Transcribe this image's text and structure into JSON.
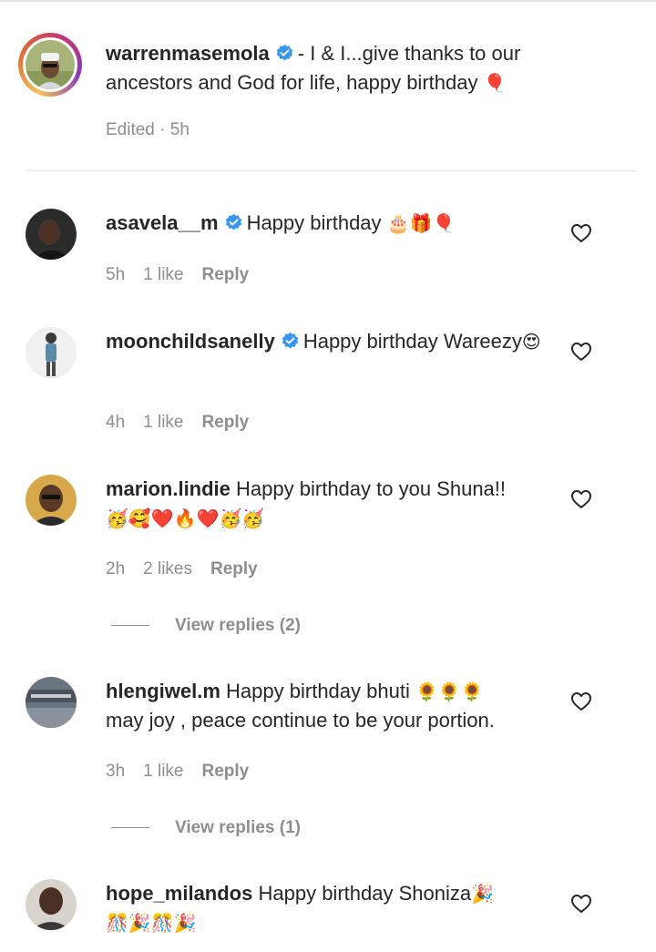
{
  "caption": {
    "username": "warrenmasemola",
    "text": "- I & I...give thanks to our ancestors and God for life, happy birthday",
    "emoji": "🎈",
    "meta": "Edited · 5h"
  },
  "comments": [
    {
      "username": "asavela__m",
      "verified": true,
      "text": "Happy birthday",
      "emoji": "🎂🎁🎈",
      "time": "5h",
      "likes": "1 like",
      "reply": "Reply"
    },
    {
      "username": "moonchildsanelly",
      "verified": true,
      "text": "Happy birthday Wareezy",
      "emoji": "😍",
      "time": "4h",
      "likes": "1 like",
      "reply": "Reply"
    },
    {
      "username": "marion.lindie",
      "verified": false,
      "text": "Happy birthday to you Shuna!!",
      "emoji": "🥳🥰❤️🔥❤️🥳🥳",
      "time": "2h",
      "likes": "2 likes",
      "reply": "Reply",
      "view_replies": "View replies (2)"
    },
    {
      "username": "hlengiwel.m",
      "verified": false,
      "text": "Happy birthday bhuti",
      "emoji": "🌻🌻🌻",
      "text2": "may joy , peace continue to be your portion.",
      "time": "3h",
      "likes": "1 like",
      "reply": "Reply",
      "view_replies": "View replies (1)"
    },
    {
      "username": "hope_milandos",
      "verified": false,
      "text": "Happy birthday Shoniza",
      "emoji": "🎉",
      "emoji2": "🎊🎉🎊🎉"
    }
  ],
  "colors": {
    "verified": "#3897f0",
    "muted": "#8e8e8e",
    "text": "#262626"
  }
}
